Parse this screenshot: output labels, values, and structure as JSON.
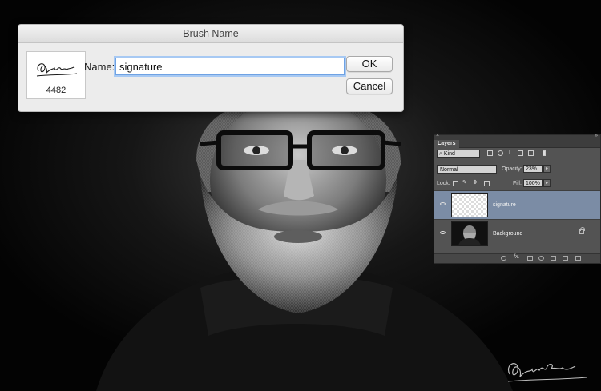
{
  "dialog": {
    "title": "Brush Name",
    "brush_size": "4482",
    "name_label": "Name:",
    "name_value": "signature",
    "ok_label": "OK",
    "cancel_label": "Cancel"
  },
  "layers_panel": {
    "tab_label": "Layers",
    "filter_kind": "⌕ Kind",
    "blend_mode": "Normal",
    "opacity_label": "Opacity:",
    "opacity_value": "23%",
    "lock_label": "Lock:",
    "fill_label": "Fill:",
    "fill_value": "100%",
    "layers": [
      {
        "name": "signature",
        "selected": true
      },
      {
        "name": "Background",
        "selected": false,
        "locked": true
      }
    ],
    "footer_fx": "fx."
  },
  "colors": {
    "selected_layer": "#7b8ca5",
    "input_focus": "#6fa2e3",
    "panel_bg": "#535353"
  },
  "icons": [
    "close-icon",
    "panel-menu-icon",
    "eye-icon",
    "lock-icon",
    "link-icon",
    "fx-icon",
    "mask-icon",
    "adjustment-icon",
    "folder-icon",
    "new-layer-icon",
    "trash-icon"
  ]
}
